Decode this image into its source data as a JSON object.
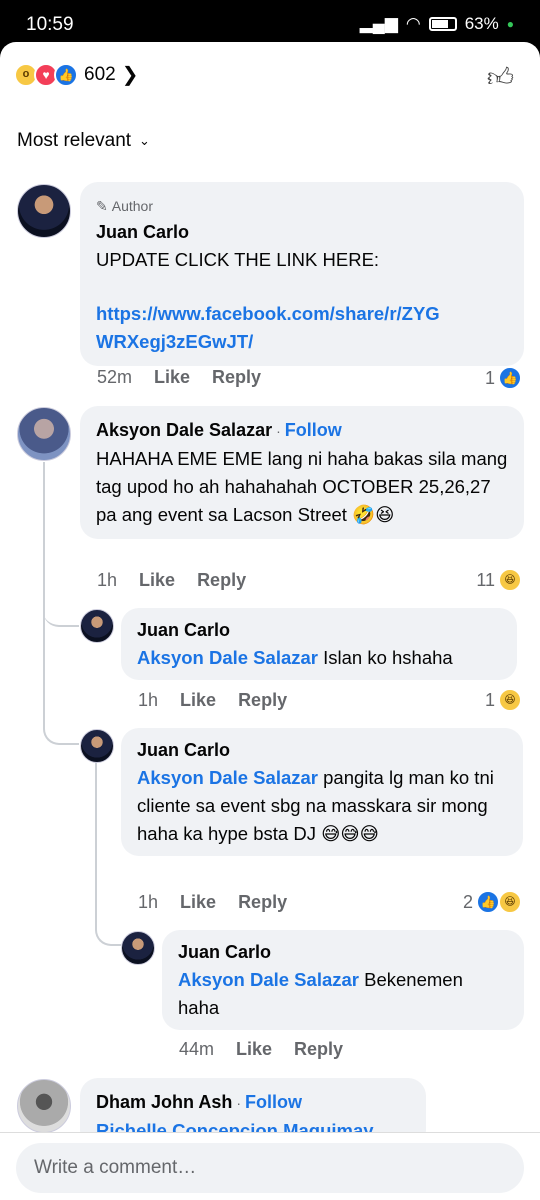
{
  "status_bar": {
    "time": "10:59",
    "battery": "63%"
  },
  "reactions": {
    "count": "602"
  },
  "sort": {
    "label": "Most relevant"
  },
  "comments": [
    {
      "author_tag": "Author",
      "name": "Juan Carlo",
      "text": "UPDATE CLICK THE LINK HERE:",
      "link_line1": "https://www.facebook.com/share/r/ZYG",
      "link_line2": "WRXegj3zEGwJT/",
      "time": "52m",
      "like": "Like",
      "reply": "Reply",
      "reaction_count": "1"
    },
    {
      "name": "Aksyon Dale Salazar",
      "follow": "Follow",
      "text": "HAHAHA EME EME lang ni haha bakas sila mang tag upod ho ah hahahahah OCTOBER 25,26,27 pa ang event sa Lacson Street 🤣😆",
      "time": "1h",
      "like": "Like",
      "reply": "Reply",
      "reaction_count": "11"
    },
    {
      "name": "Juan Carlo",
      "mention": "Aksyon Dale Salazar",
      "text": " Islan ko hshaha",
      "time": "1h",
      "like": "Like",
      "reply": "Reply",
      "reaction_count": "1"
    },
    {
      "name": "Juan Carlo",
      "mention": "Aksyon Dale Salazar",
      "text": " pangita lg man ko tni cliente sa event sbg na masskara sir mong haha ka hype bsta DJ 😅😅😅",
      "time": "1h",
      "like": "Like",
      "reply": "Reply",
      "reaction_count": "2"
    },
    {
      "name": "Juan Carlo",
      "mention": "Aksyon Dale Salazar",
      "text": " Bekenemen haha",
      "time": "44m",
      "like": "Like",
      "reply": "Reply"
    },
    {
      "name": "Dham John Ash",
      "follow": "Follow",
      "mention": "Richelle Concepcion Maquimay"
    }
  ],
  "composer": {
    "placeholder": "Write a comment…"
  }
}
